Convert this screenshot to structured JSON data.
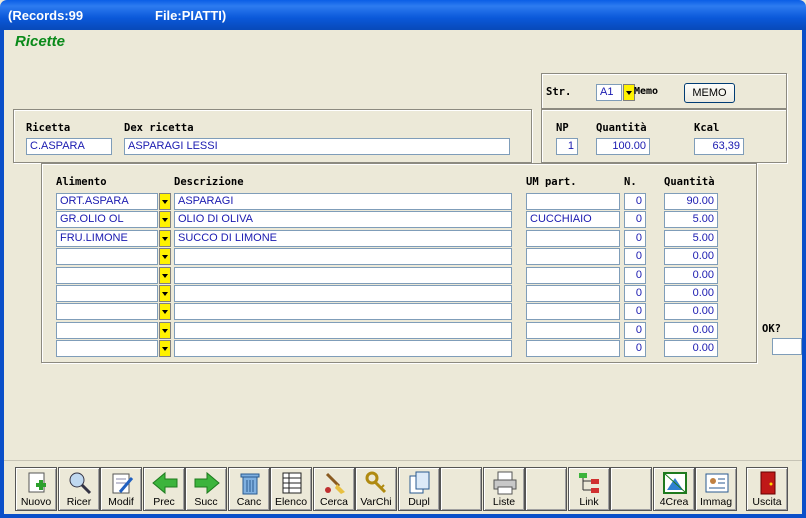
{
  "window": {
    "records_label": "(Records:99",
    "file_label": "File:PIATTI)",
    "app_title": "Ricette"
  },
  "header": {
    "ricetta_label": "Ricetta",
    "ricetta_value": "C.ASPARA",
    "dex_label": "Dex ricetta",
    "dex_value": "ASPARAGI LESSI",
    "str_label": "Str.",
    "str_value": "A1",
    "memo_label": "Memo",
    "memo_button": "MEMO",
    "np_label": "NP",
    "np_value": "1",
    "quantita_label": "Quantità",
    "quantita_value": "100.00",
    "kcal_label": "Kcal",
    "kcal_value": "63,39"
  },
  "grid": {
    "columns": [
      "Alimento",
      "Descrizione",
      "UM part.",
      "N.",
      "Quantità"
    ],
    "rows": [
      {
        "alimento": "ORT.ASPARA",
        "descrizione": "ASPARAGI",
        "um": "",
        "n": "0",
        "quantita": "90.00"
      },
      {
        "alimento": "GR.OLIO OL",
        "descrizione": "OLIO DI OLIVA",
        "um": "CUCCHIAIO",
        "n": "0",
        "quantita": "5.00"
      },
      {
        "alimento": "FRU.LIMONE",
        "descrizione": "SUCCO DI LIMONE",
        "um": "",
        "n": "0",
        "quantita": "5.00"
      },
      {
        "alimento": "",
        "descrizione": "",
        "um": "",
        "n": "0",
        "quantita": "0.00"
      },
      {
        "alimento": "",
        "descrizione": "",
        "um": "",
        "n": "0",
        "quantita": "0.00"
      },
      {
        "alimento": "",
        "descrizione": "",
        "um": "",
        "n": "0",
        "quantita": "0.00"
      },
      {
        "alimento": "",
        "descrizione": "",
        "um": "",
        "n": "0",
        "quantita": "0.00"
      },
      {
        "alimento": "",
        "descrizione": "",
        "um": "",
        "n": "0",
        "quantita": "0.00"
      },
      {
        "alimento": "",
        "descrizione": "",
        "um": "",
        "n": "0",
        "quantita": "0.00"
      }
    ]
  },
  "ok_label": "OK?",
  "toolbar": {
    "buttons": [
      {
        "label": "Nuovo",
        "icon": "new-document-icon"
      },
      {
        "label": "Ricer",
        "icon": "magnifier-icon"
      },
      {
        "label": "Modif",
        "icon": "edit-document-icon"
      },
      {
        "label": "Prec",
        "icon": "arrow-left-icon"
      },
      {
        "label": "Succ",
        "icon": "arrow-right-icon"
      },
      {
        "label": "Canc",
        "icon": "trash-icon"
      },
      {
        "label": "Elenco",
        "icon": "list-table-icon"
      },
      {
        "label": "Cerca",
        "icon": "search-broom-icon"
      },
      {
        "label": "VarChi",
        "icon": "keys-icon"
      },
      {
        "label": "Dupl",
        "icon": "duplicate-icon"
      },
      {
        "label": "",
        "icon": ""
      },
      {
        "label": "Liste",
        "icon": "printer-icon"
      },
      {
        "label": "",
        "icon": ""
      },
      {
        "label": "Link",
        "icon": "link-tree-icon"
      },
      {
        "label": "",
        "icon": ""
      },
      {
        "label": "4Crea",
        "icon": "create-icon"
      },
      {
        "label": "Immag",
        "icon": "image-card-icon"
      },
      {
        "label": "",
        "icon": ""
      },
      {
        "label": "Uscita",
        "icon": "exit-door-icon"
      }
    ]
  },
  "colors": {
    "title_green": "#0A8A1A",
    "dropdown_yellow": "#FFF200",
    "value_blue": "#1A1AB0"
  }
}
